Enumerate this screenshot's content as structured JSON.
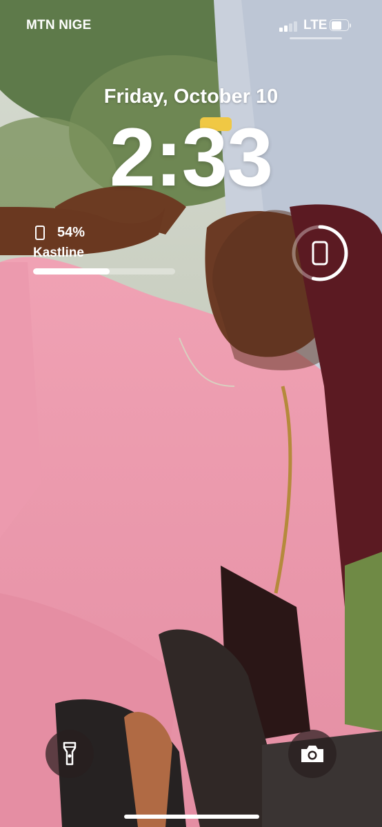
{
  "status_bar": {
    "carrier": "MTN NIGE",
    "network": "LTE",
    "signal_bars_active": 2,
    "signal_bars_total": 4
  },
  "lock_screen": {
    "date": "Friday, October 10",
    "time": "2:33"
  },
  "battery_widget": {
    "percent_label": "54%",
    "level": 0.54,
    "device_name": "Kastline",
    "icon": "phone-icon"
  },
  "ring_widget": {
    "icon": "phone-icon",
    "level": 0.54
  },
  "quick_actions": {
    "flashlight_icon": "flashlight-icon",
    "camera_icon": "camera-icon"
  },
  "colors": {
    "text": "#ffffff",
    "button_bg": "#2a1f1f"
  }
}
